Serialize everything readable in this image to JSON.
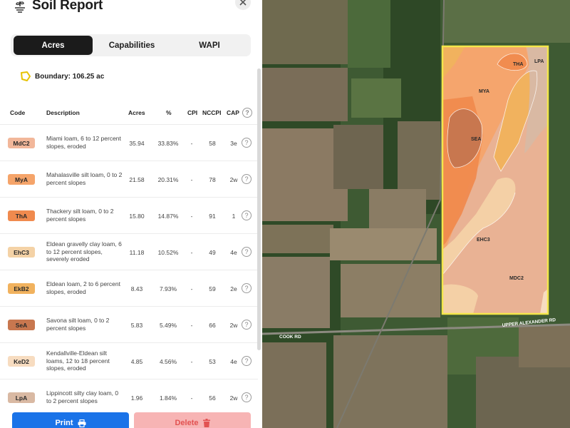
{
  "app": {
    "title": "Soil Report",
    "close_icon": "close-icon",
    "logo_icon": "soil-logo-icon"
  },
  "tabs": [
    {
      "label": "Acres",
      "active": true
    },
    {
      "label": "Capabilities",
      "active": false
    },
    {
      "label": "WAPI",
      "active": false
    }
  ],
  "boundary": {
    "label": "Boundary: 106.25 ac",
    "icon": "boundary-polygon-icon",
    "color": "#e6c200"
  },
  "table": {
    "columns": [
      "Code",
      "Description",
      "Acres",
      "%",
      "CPI",
      "NCCPI",
      "CAP"
    ],
    "help_symbol": "?",
    "rows": [
      {
        "code": "MdC2",
        "color": "#f2b79a",
        "description": "Miami loam, 6 to 12 percent slopes, eroded",
        "acres": "35.94",
        "pct": "33.83%",
        "cpi": "-",
        "nccpi": "58",
        "cap": "3e"
      },
      {
        "code": "MyA",
        "color": "#f5a46a",
        "description": "Mahalasville silt loam, 0 to 2 percent slopes",
        "acres": "21.58",
        "pct": "20.31%",
        "cpi": "-",
        "nccpi": "78",
        "cap": "2w"
      },
      {
        "code": "ThA",
        "color": "#f08a4e",
        "description": "Thackery silt loam, 0 to 2 percent slopes",
        "acres": "15.80",
        "pct": "14.87%",
        "cpi": "-",
        "nccpi": "91",
        "cap": "1"
      },
      {
        "code": "EhC3",
        "color": "#f4d2a6",
        "description": "Eldean gravelly clay loam, 6 to 12 percent slopes, severely eroded",
        "acres": "11.18",
        "pct": "10.52%",
        "cpi": "-",
        "nccpi": "49",
        "cap": "4e"
      },
      {
        "code": "EkB2",
        "color": "#f1b25e",
        "description": "Eldean loam, 2 to 6 percent slopes, eroded",
        "acres": "8.43",
        "pct": "7.93%",
        "cpi": "-",
        "nccpi": "59",
        "cap": "2e"
      },
      {
        "code": "SeA",
        "color": "#c8774f",
        "description": "Savona silt loam, 0 to 2 percent slopes",
        "acres": "5.83",
        "pct": "5.49%",
        "cpi": "-",
        "nccpi": "66",
        "cap": "2w"
      },
      {
        "code": "KeD2",
        "color": "#f7dcc0",
        "description": "Kendallville-Eldean silt loams, 12 to 18 percent slopes, eroded",
        "acres": "4.85",
        "pct": "4.56%",
        "cpi": "-",
        "nccpi": "53",
        "cap": "4e"
      },
      {
        "code": "LpA",
        "color": "#d9b9a3",
        "description": "Lippincott silty clay loam, 0 to 2 percent slopes",
        "acres": "1.96",
        "pct": "1.84%",
        "cpi": "-",
        "nccpi": "56",
        "cap": "2w"
      }
    ]
  },
  "footer": {
    "print_label": "Print",
    "print_icon": "printer-icon",
    "delete_label": "Delete",
    "delete_icon": "trash-icon"
  },
  "map": {
    "soil_labels": [
      "THA",
      "LPA",
      "MYA",
      "SEA",
      "EHC3",
      "MDC2"
    ],
    "road_labels": [
      "COOK RD",
      "UPPER ALEXANDER RD"
    ],
    "boundary_color": "#f3e64a"
  }
}
